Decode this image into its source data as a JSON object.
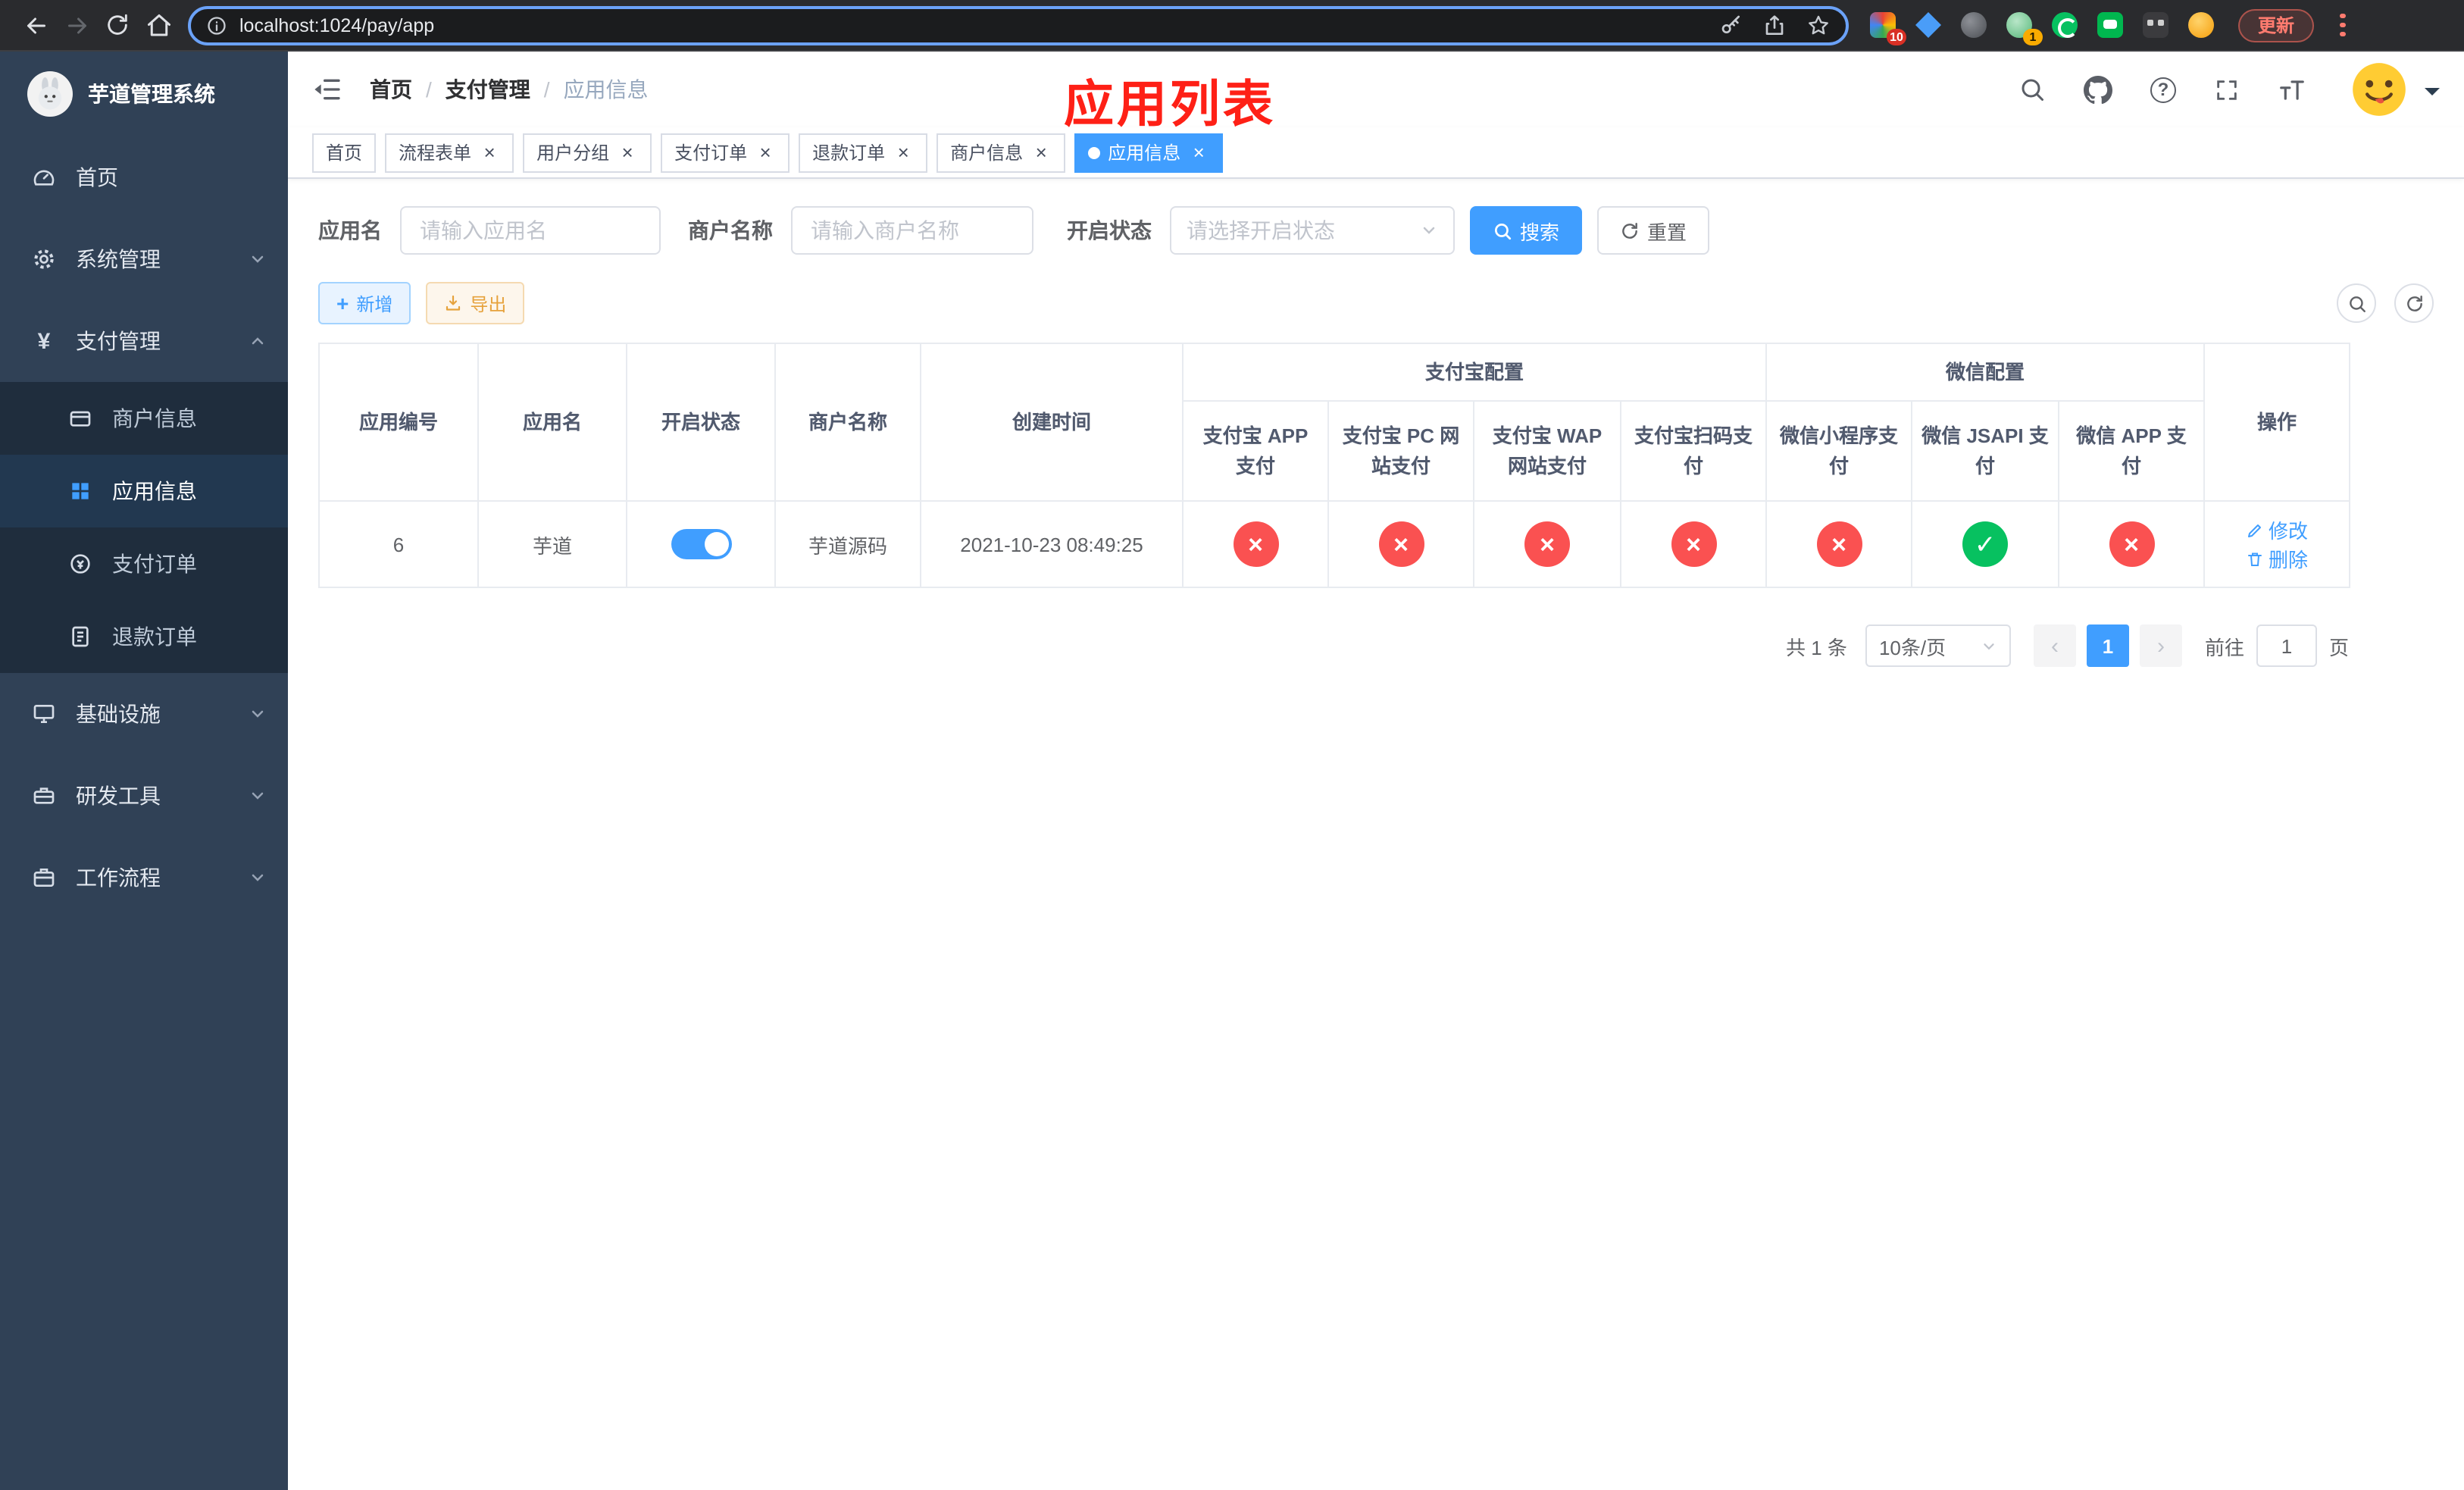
{
  "browser": {
    "url": "localhost:1024/pay/app",
    "update_label": "更新",
    "ext_badges": [
      "10",
      "1"
    ]
  },
  "colors": {
    "accent": "#409eff",
    "success": "#07c160",
    "danger": "#fa5151",
    "sidebar_bg": "#304156",
    "annotation": "#fe2016"
  },
  "icons": {
    "check": "✓",
    "cross": "×",
    "close": "×",
    "dot": "●",
    "slash": "/",
    "plus": "+",
    "yen": "¥",
    "prev": "‹",
    "next": "›",
    "question": "?"
  },
  "sidebar": {
    "title": "芋道管理系统",
    "items": [
      {
        "label": "首页"
      },
      {
        "label": "系统管理"
      },
      {
        "label": "支付管理"
      },
      {
        "label": "基础设施"
      },
      {
        "label": "研发工具"
      },
      {
        "label": "工作流程"
      }
    ],
    "submenu": [
      {
        "label": "商户信息"
      },
      {
        "label": "应用信息"
      },
      {
        "label": "支付订单"
      },
      {
        "label": "退款订单"
      }
    ]
  },
  "header": {
    "breadcrumb": [
      "首页",
      "支付管理",
      "应用信息"
    ],
    "annotation": "应用列表"
  },
  "tabs": [
    {
      "label": "首页"
    },
    {
      "label": "流程表单"
    },
    {
      "label": "用户分组"
    },
    {
      "label": "支付订单"
    },
    {
      "label": "退款订单"
    },
    {
      "label": "商户信息"
    },
    {
      "label": "应用信息"
    }
  ],
  "filters": {
    "app_name": {
      "label": "应用名",
      "placeholder": "请输入应用名"
    },
    "merchant": {
      "label": "商户名称",
      "placeholder": "请输入商户名称"
    },
    "status": {
      "label": "开启状态",
      "placeholder": "请选择开启状态"
    },
    "search": "搜索",
    "reset": "重置"
  },
  "toolbar": {
    "add": "新增",
    "export": "导出"
  },
  "table": {
    "groups": {
      "alipay": "支付宝配置",
      "wechat": "微信配置"
    },
    "columns": [
      "应用编号",
      "应用名",
      "开启状态",
      "商户名称",
      "创建时间",
      "支付宝 APP 支付",
      "支付宝 PC 网站支付",
      "支付宝 WAP 网站支付",
      "支付宝扫码支付",
      "微信小程序支付",
      "微信 JSAPI 支付",
      "微信 APP 支付",
      "操作"
    ],
    "rows": [
      {
        "id": "6",
        "name": "芋道",
        "enabled": true,
        "merchant": "芋道源码",
        "created": "2021-10-23 08:49:25",
        "statuses": [
          false,
          false,
          false,
          false,
          false,
          true,
          false
        ],
        "edit": "修改",
        "delete": "删除"
      }
    ]
  },
  "pagination": {
    "total": "共 1 条",
    "page_size": "10条/页",
    "page": "1",
    "goto": "前往",
    "goto_value": "1",
    "unit": "页"
  }
}
